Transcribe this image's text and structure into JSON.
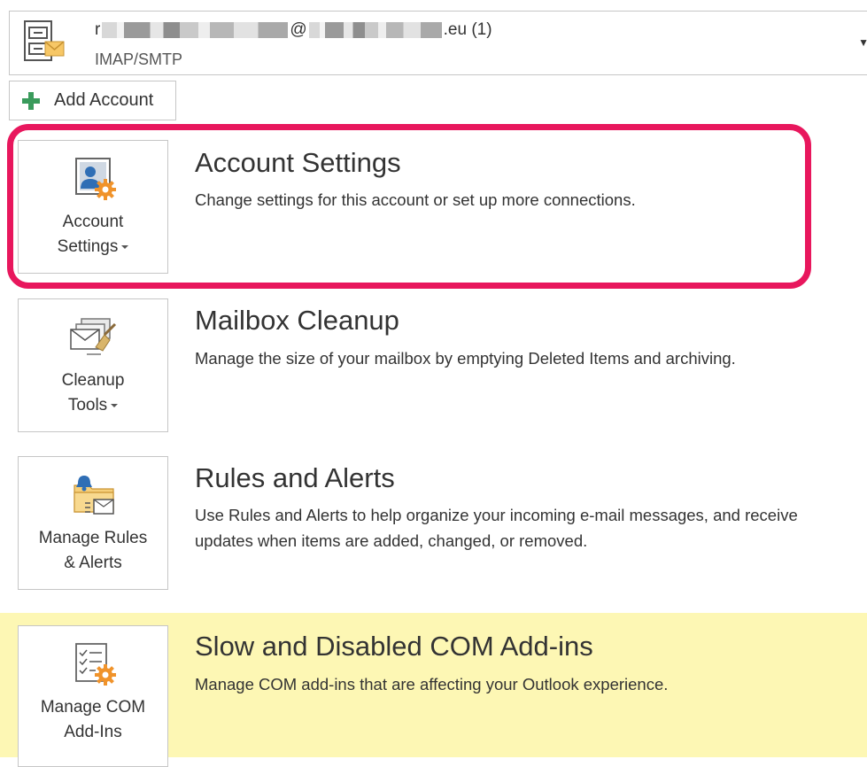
{
  "account": {
    "email_prefix": "r",
    "email_at": "@",
    "email_suffix": ".eu (1)",
    "type": "IMAP/SMTP",
    "dropdown_glyph": "▼"
  },
  "add_account": {
    "label": "Add Account"
  },
  "sections": [
    {
      "id": "account-settings",
      "title": "Account Settings",
      "description": [
        "Change settings for this account or set up more connections."
      ],
      "tile_label": [
        "Account",
        "Settings"
      ],
      "has_dropdown": true,
      "icon": "account-settings-icon"
    },
    {
      "id": "mailbox-cleanup",
      "title": "Mailbox Cleanup",
      "description": [
        "Manage the size of your mailbox by emptying Deleted Items and archiving."
      ],
      "tile_label": [
        "Cleanup",
        "Tools"
      ],
      "has_dropdown": true,
      "icon": "cleanup-tools-icon"
    },
    {
      "id": "rules-alerts",
      "title": "Rules and Alerts",
      "description": [
        "Use Rules and Alerts to help organize your incoming e-mail messages, and receive",
        "updates when items are added, changed, or removed."
      ],
      "tile_label": [
        "Manage Rules",
        "& Alerts"
      ],
      "has_dropdown": false,
      "icon": "rules-alerts-icon"
    },
    {
      "id": "com-addins",
      "title": "Slow and Disabled COM Add-ins",
      "description": [
        "Manage COM add-ins that are affecting your Outlook experience."
      ],
      "tile_label": [
        "Manage COM",
        "Add-Ins"
      ],
      "has_dropdown": false,
      "icon": "com-addins-icon"
    }
  ],
  "colors": {
    "highlight": "#e8175d",
    "section_yellow": "#fdf7b4",
    "gear_orange": "#f0932b",
    "person_blue": "#2f6eb5",
    "plus_green": "#3a9b5c"
  }
}
